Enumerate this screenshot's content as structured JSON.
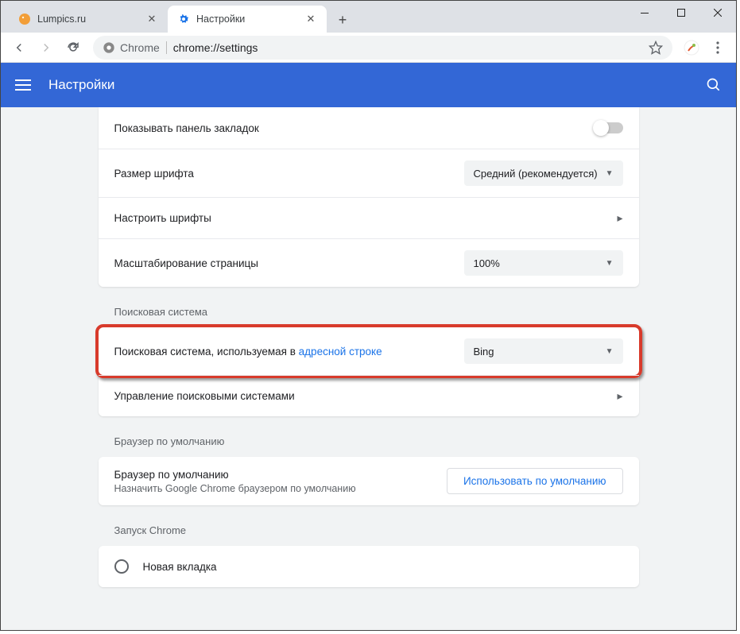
{
  "tabs": [
    {
      "title": "Lumpics.ru",
      "favicon": "orange"
    },
    {
      "title": "Настройки",
      "favicon": "gear"
    }
  ],
  "addressbar": {
    "protocol_label": "Chrome",
    "url": "chrome://settings"
  },
  "header": {
    "title": "Настройки"
  },
  "settings": {
    "bookmarks_bar": "Показывать панель закладок",
    "font_size_label": "Размер шрифта",
    "font_size_value": "Средний (рекомендуется)",
    "customize_fonts": "Настроить шрифты",
    "page_zoom_label": "Масштабирование страницы",
    "page_zoom_value": "100%"
  },
  "search": {
    "section_title": "Поисковая система",
    "engine_label_pre": "Поисковая система, используемая в ",
    "engine_label_link": "адресной строке",
    "engine_value": "Bing",
    "manage": "Управление поисковыми системами"
  },
  "default_browser": {
    "section_title": "Браузер по умолчанию",
    "label": "Браузер по умолчанию",
    "sublabel": "Назначить Google Chrome браузером по умолчанию",
    "button": "Использовать по умолчанию"
  },
  "startup": {
    "section_title": "Запуск Chrome",
    "new_tab": "Новая вкладка"
  }
}
